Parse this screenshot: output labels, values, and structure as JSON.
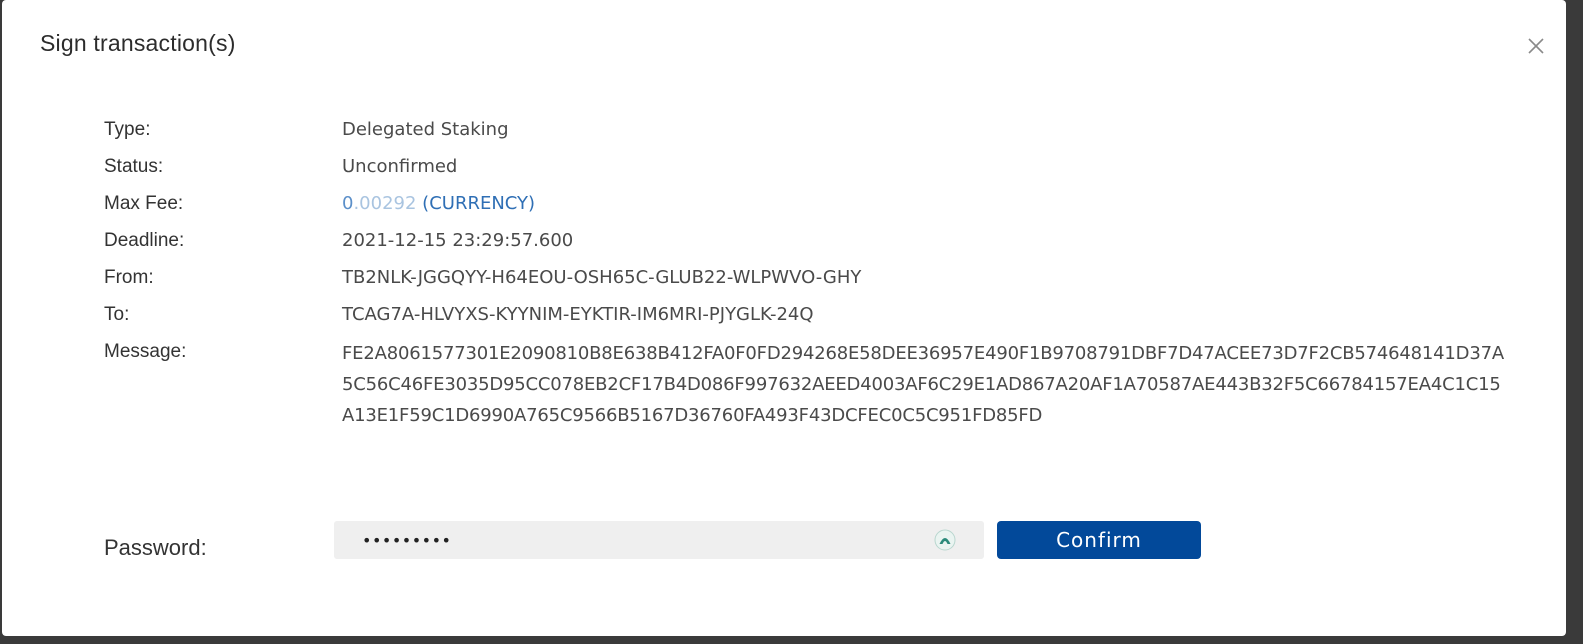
{
  "dialog": {
    "title": "Sign transaction(s)"
  },
  "details": {
    "type_label": "Type:",
    "type_value": "Delegated Staking",
    "status_label": "Status:",
    "status_value": "Unconfirmed",
    "max_fee_label": "Max Fee:",
    "max_fee_int": "0",
    "max_fee_dec": ".00292",
    "max_fee_currency": "(CURRENCY)",
    "deadline_label": "Deadline:",
    "deadline_value": "2021-12-15 23:29:57.600",
    "from_label": "From:",
    "from_value": "TB2NLK-JGGQYY-H64EOU-OSH65C-GLUB22-WLPWVO-GHY",
    "to_label": "To:",
    "to_value": "TCAG7A-HLVYXS-KYYNIM-EYKTIR-IM6MRI-PJYGLK-24Q",
    "message_label": "Message:",
    "message_value": "FE2A8061577301E2090810B8E638B412FA0F0FD294268E58DEE36957E490F1B9708791DBF7D47ACEE73D7F2CB574648141D37A5C56C46FE3035D95CC078EB2CF17B4D086F997632AEED4003AF6C29E1AD867A20AF1A70587AE443B32F5C66784157EA4C1C15A13E1F59C1D6990A765C9566B5167D36760FA493F43DCFEC0C5C951FD85FD"
  },
  "password": {
    "label": "Password:",
    "value": "•••••••••"
  },
  "actions": {
    "confirm_label": "Confirm"
  },
  "colors": {
    "primary": "#02499a",
    "fee_integer": "#5b8fc9",
    "fee_decimal": "#a9c4e0",
    "fee_currency": "#2f6fb5"
  },
  "icons": {
    "close": "close-icon",
    "password_manager": "password-manager-icon"
  }
}
